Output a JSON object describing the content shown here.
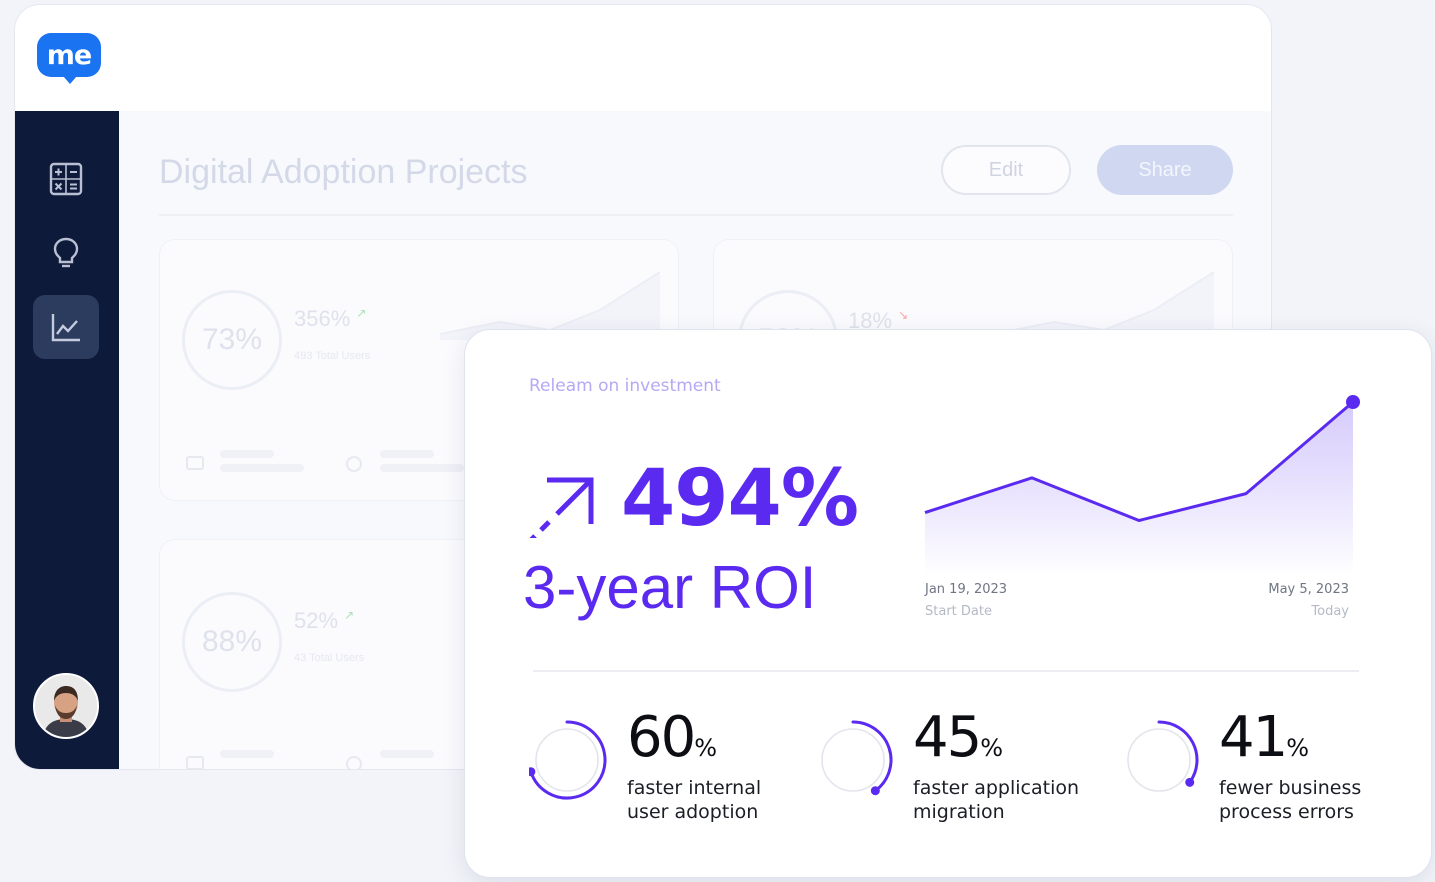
{
  "app": {
    "logo_text": "me",
    "page_title": "Digital Adoption Projects",
    "edit_label": "Edit",
    "share_label": "Share",
    "sidebar": [
      {
        "icon": "calculator-icon",
        "active": false
      },
      {
        "icon": "lightbulb-icon",
        "active": false
      },
      {
        "icon": "line-chart-icon",
        "active": true
      }
    ],
    "bg_cards": [
      {
        "circle": "73%",
        "stat": "356%",
        "sub": "493 Total Users"
      },
      {
        "circle": "50%",
        "stat": "18%",
        "sub": ""
      },
      {
        "circle": "88%",
        "stat": "52%",
        "sub": "43 Total Users"
      }
    ]
  },
  "roi": {
    "label": "Releam on investment",
    "value": "494%",
    "subtitle": "3-year ROI",
    "start_date": "Jan 19, 2023",
    "start_caption": "Start Date",
    "end_date": "May 5, 2023",
    "end_caption": "Today",
    "accent": "#5b2af0"
  },
  "chart_data": {
    "type": "area",
    "series": [
      {
        "values": [
          0.3,
          0.52,
          0.25,
          0.42,
          1.0
        ]
      }
    ]
  },
  "metrics": [
    {
      "value": "60",
      "unit": "%",
      "description": "faster internal\nuser adoption",
      "fraction": 0.7
    },
    {
      "value": "45",
      "unit": "%",
      "description": "faster application\nmigration",
      "fraction": 0.4
    },
    {
      "value": "41",
      "unit": "%",
      "description": "fewer business\nprocess errors",
      "fraction": 0.35
    }
  ]
}
